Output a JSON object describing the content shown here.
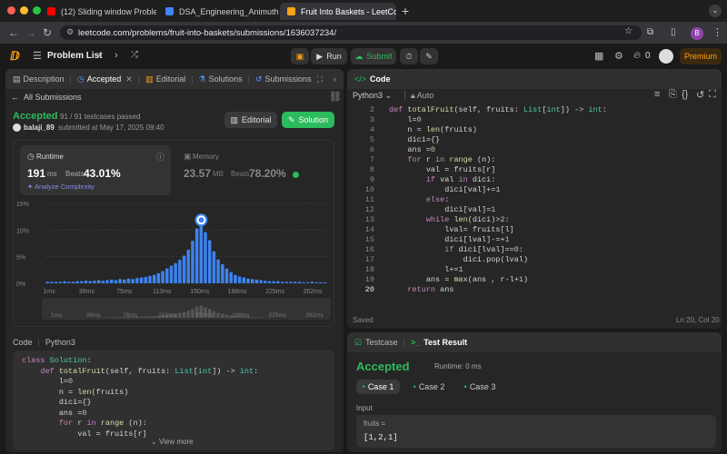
{
  "browser": {
    "tabs": [
      {
        "label": "(12) Sliding window Problem",
        "color": "#ff0000"
      },
      {
        "label": "DSA_Engineering_Animuthyam",
        "color": "#4285f4"
      },
      {
        "label": "Fruit Into Baskets - LeetCode",
        "color": "#ffa116"
      }
    ],
    "url": "leetcode.com/problems/fruit-into-baskets/submissions/1636037234/",
    "profile_initial": "B"
  },
  "leetcode": {
    "problem_list": "Problem List",
    "run": "Run",
    "submit": "Submit",
    "streak": "0",
    "premium": "Premium"
  },
  "left": {
    "tabs": [
      "Description",
      "Accepted",
      "Editorial",
      "Solutions",
      "Submissions"
    ],
    "all_submissions": "All Submissions",
    "status": "Accepted",
    "testcases": "91 / 91 testcases passed",
    "user": "balaji_89",
    "submitted": "submitted at May 17, 2025 09:40",
    "editorial_btn": "Editorial",
    "solution_btn": "Solution",
    "runtime_label": "Runtime",
    "runtime_value": "191",
    "runtime_unit": "ms",
    "beats_label": "Beats",
    "runtime_beats": "43.01%",
    "analyze": "Analyze Complexity",
    "memory_label": "Memory",
    "memory_value": "23.57",
    "memory_unit": "MB",
    "memory_beats": "78.20%",
    "code_label": "Code",
    "code_lang": "Python3",
    "view_more": "View more"
  },
  "chart_data": {
    "type": "bar",
    "title": "",
    "xlabel": "",
    "ylabel": "",
    "ylim": [
      0,
      15
    ],
    "yticks": [
      "15%",
      "10%",
      "5%",
      "0%"
    ],
    "xticks": [
      "1ms",
      "39ms",
      "75ms",
      "113ms",
      "150ms",
      "188ms",
      "225ms",
      "262ms"
    ],
    "mini_xticks": [
      "1ms",
      "39ms",
      "76ms",
      "113ms",
      "150ms",
      "188ms",
      "225ms",
      "262ms"
    ],
    "values": [
      0.3,
      0.3,
      0.3,
      0.3,
      0.4,
      0.3,
      0.3,
      0.4,
      0.4,
      0.5,
      0.4,
      0.5,
      0.6,
      0.5,
      0.6,
      0.7,
      0.6,
      0.8,
      0.7,
      0.9,
      0.8,
      1.0,
      1.1,
      1.2,
      1.4,
      1.6,
      1.9,
      2.3,
      2.8,
      3.3,
      3.8,
      4.4,
      5.2,
      6.3,
      8.0,
      10.3,
      11.2,
      9.6,
      8.1,
      6.0,
      4.5,
      3.6,
      2.8,
      2.1,
      1.6,
      1.3,
      1.1,
      0.9,
      0.8,
      0.7,
      0.6,
      0.5,
      0.4,
      0.4,
      0.4,
      0.3,
      0.3,
      0.3,
      0.3,
      0.3,
      0.2,
      0.2,
      0.3,
      0.2,
      0.2,
      0.2
    ],
    "highlight_index": 36
  },
  "left_code": [
    "class Solution:",
    "    def totalFruit(self, fruits: List[int]) -> int:",
    "        l=0",
    "        n = len(fruits)",
    "        dici={}",
    "        ans =0",
    "        for r in range (n):",
    "            val = fruits[r]"
  ],
  "editor": {
    "title": "Code",
    "lang": "Python3",
    "mode": "Auto",
    "status": "Saved",
    "cursor": "Ln 20, Col 20",
    "line_start": 2,
    "lines": [
      "def totalFruit(self, fruits: List[int]) -> int:",
      "    l=0",
      "    n = len(fruits)",
      "    dici={}",
      "    ans =0",
      "    for r in range (n):",
      "        val = fruits[r]",
      "        if val in dici:",
      "            dici[val]+=1",
      "        else:",
      "            dici[val]=1",
      "        while len(dici)>2:",
      "            lval= fruits[l]",
      "            dici[lval]-=+1",
      "            if dici[lval]==0:",
      "                dici.pop(lval)",
      "            l+=1",
      "        ans = max(ans , r-l+1)",
      "    return ans"
    ]
  },
  "result": {
    "tab_testcase": "Testcase",
    "tab_result": "Test Result",
    "status": "Accepted",
    "runtime": "Runtime: 0 ms",
    "cases": [
      "Case 1",
      "Case 2",
      "Case 3"
    ],
    "input_label": "Input",
    "var_name": "fruits =",
    "var_value": "[1,2,1]"
  }
}
